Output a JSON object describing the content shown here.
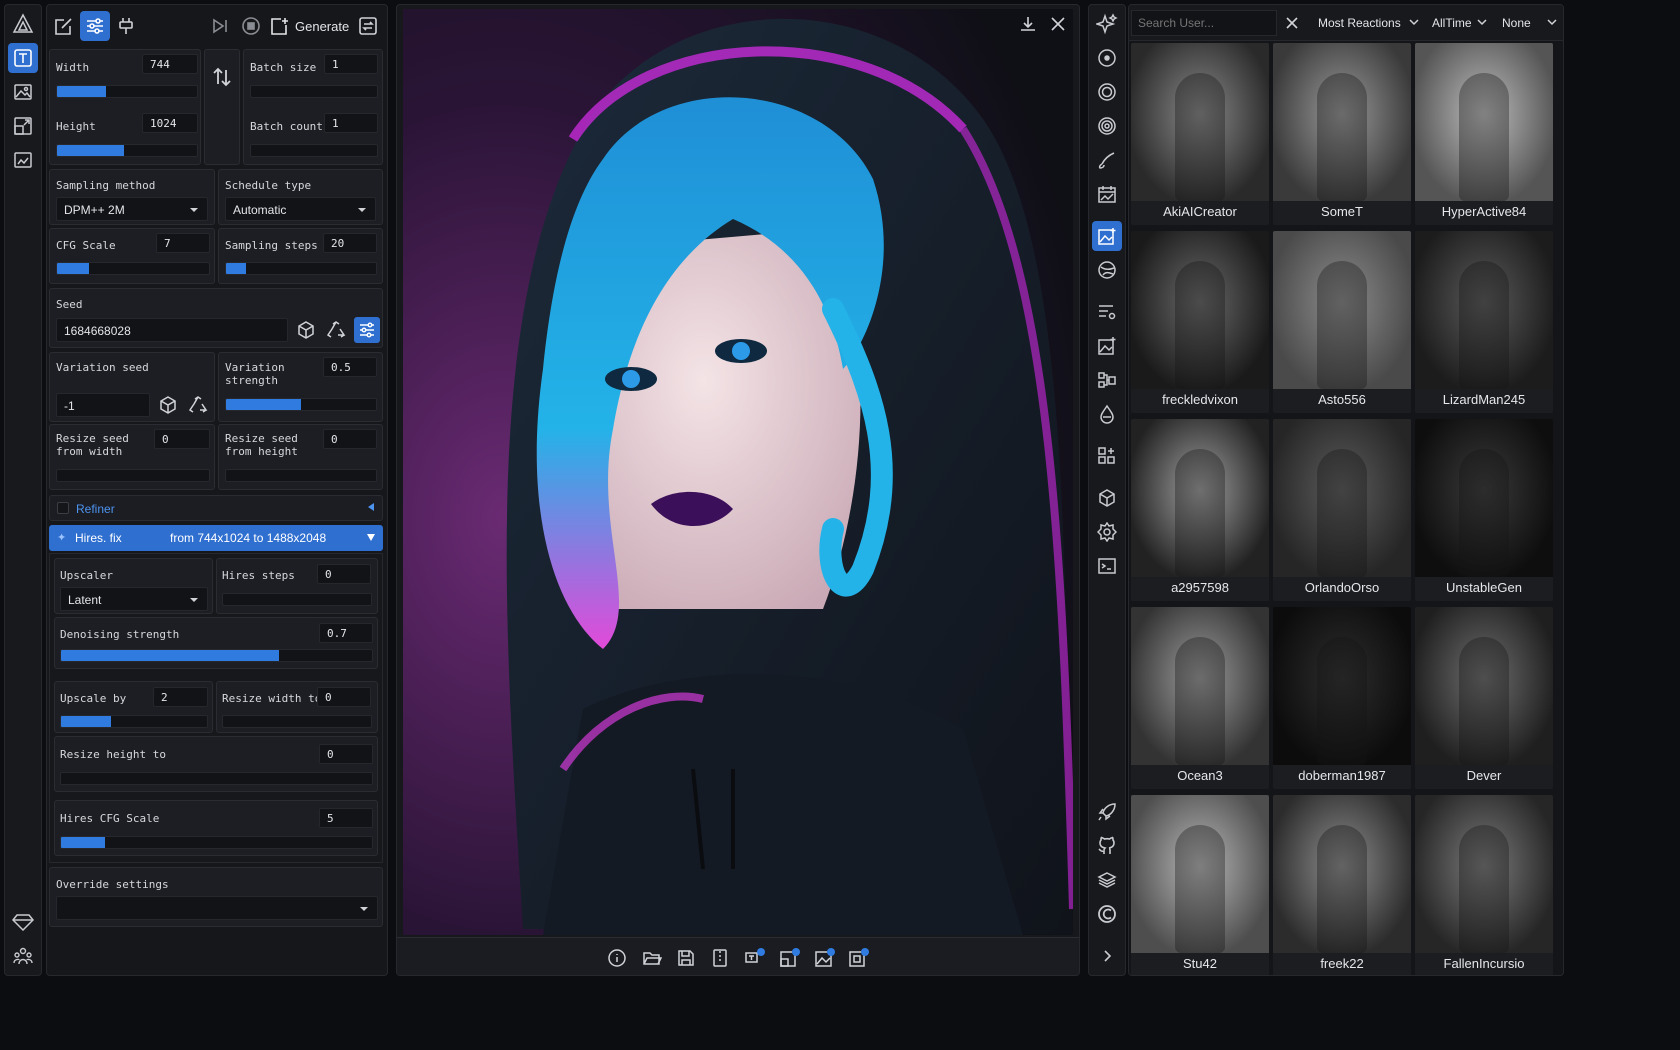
{
  "toolbar": {
    "generate_label": "Generate"
  },
  "dims": {
    "width_label": "Width",
    "width_value": "744",
    "width_fill": 0.35,
    "height_label": "Height",
    "height_value": "1024",
    "height_fill": 0.48,
    "batch_size_label": "Batch size",
    "batch_size_value": "1",
    "batch_count_label": "Batch count",
    "batch_count_value": "1"
  },
  "sampling": {
    "method_label": "Sampling method",
    "method_value": "DPM++ 2M",
    "schedule_label": "Schedule type",
    "schedule_value": "Automatic",
    "cfg_label": "CFG Scale",
    "cfg_value": "7",
    "cfg_fill": 0.21,
    "steps_label": "Sampling steps",
    "steps_value": "20",
    "steps_fill": 0.13
  },
  "seed": {
    "label": "Seed",
    "value": "1684668028",
    "variation_label": "Variation seed",
    "variation_value": "-1",
    "var_strength_label_1": "Variation",
    "var_strength_label_2": "strength",
    "var_strength_value": "0.5",
    "var_strength_fill": 0.5,
    "resize_w_label_1": "Resize seed",
    "resize_w_label_2": "from width",
    "resize_w_value": "0",
    "resize_h_label_1": "Resize seed",
    "resize_h_label_2": "from height",
    "resize_h_value": "0"
  },
  "refiner": {
    "label": "Refiner"
  },
  "hires": {
    "label": "Hires. fix",
    "summary": "from 744x1024 to 1488x2048",
    "upscaler_label": "Upscaler",
    "upscaler_value": "Latent",
    "steps_label": "Hires steps",
    "steps_value": "0",
    "denoise_label": "Denoising strength",
    "denoise_value": "0.7",
    "denoise_fill": 0.7,
    "upscale_by_label": "Upscale by",
    "upscale_by_value": "2",
    "upscale_by_fill": 0.34,
    "resize_width_label": "Resize width to",
    "resize_width_value": "0",
    "resize_height_label": "Resize height to",
    "resize_height_value": "0",
    "cfg_label": "Hires CFG Scale",
    "cfg_value": "5",
    "cfg_fill": 0.14
  },
  "override": {
    "label": "Override settings"
  },
  "gallery": {
    "search_placeholder": "Search User...",
    "sort_value": "Most Reactions",
    "period_value": "AllTime",
    "filter_value": "None",
    "users": [
      "AkiAICreator",
      "SomeT",
      "HyperActive84",
      "freckledvixon",
      "Asto556",
      "LizardMan245",
      "a2957598",
      "OrlandoOrso",
      "UnstableGen",
      "Ocean3",
      "doberman1987",
      "Dever",
      "Stu42",
      "freek22",
      "FallenIncursio"
    ]
  },
  "colors": {
    "accent": "#2f7be0",
    "panel": "#16171b",
    "background": "#0c0d10"
  }
}
